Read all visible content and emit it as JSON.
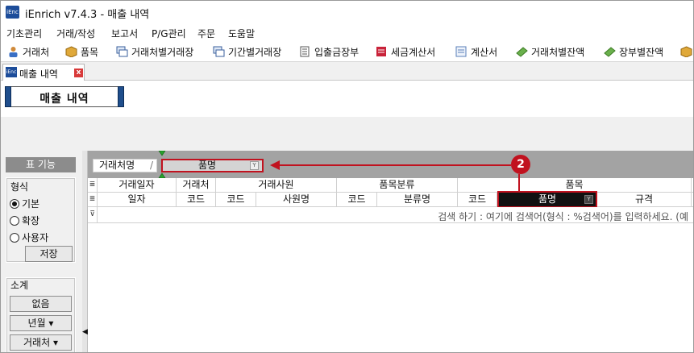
{
  "window": {
    "title": "iEnrich v7.4.3 - 매출 내역",
    "app_icon_text": "iEnc"
  },
  "menu": [
    "기초관리",
    "거래/작성",
    "보고서",
    "P/G관리",
    "주문",
    "도움말"
  ],
  "toolbar": [
    {
      "label": "거래처",
      "icon": "person-icon"
    },
    {
      "label": "품목",
      "icon": "box-icon"
    },
    {
      "label": "거래처별거래장",
      "icon": "ledger-icon"
    },
    {
      "label": "기간별거래장",
      "icon": "ledger-icon"
    },
    {
      "label": "입출금장부",
      "icon": "book-icon"
    },
    {
      "label": "세금계산서",
      "icon": "invoice-icon"
    },
    {
      "label": "계산서",
      "icon": "sheet-icon"
    },
    {
      "label": "거래처별잔액",
      "icon": "money-icon"
    },
    {
      "label": "장부별잔액",
      "icon": "money-icon"
    }
  ],
  "doc_tab": {
    "label": "매출 내역",
    "close": "x"
  },
  "page_title": "매출 내역",
  "left_panel": {
    "header": "표 기능",
    "format_group": {
      "label": "형식",
      "options": [
        "기본",
        "확장",
        "사용자"
      ],
      "selected": "기본",
      "save_button": "저장"
    },
    "subtotal_group": {
      "label": "소계",
      "buttons": [
        "없음",
        "년월 ▾",
        "거래처 ▾"
      ]
    }
  },
  "grid": {
    "group_chips": [
      {
        "label": "거래처명",
        "sort": "/"
      },
      {
        "label": "품명",
        "filter": "filter-icon"
      }
    ],
    "band_headers": [
      "거래일자",
      "거래처",
      "거래사원",
      "품목분류",
      "품목"
    ],
    "columns": [
      "일자",
      "코드",
      "코드",
      "사원명",
      "코드",
      "분류명",
      "코드",
      "품명",
      "규격"
    ],
    "filter_row_text": "검색 하기 : 여기에 검색어(형식 : %검색어)를 입력하세요. (예"
  },
  "callout": {
    "number": "2",
    "color": "#c1121f"
  },
  "colors": {
    "title_cap": "#1f4e8c",
    "group_panel": "#a3a3a3",
    "highlight": "#c1121f"
  }
}
